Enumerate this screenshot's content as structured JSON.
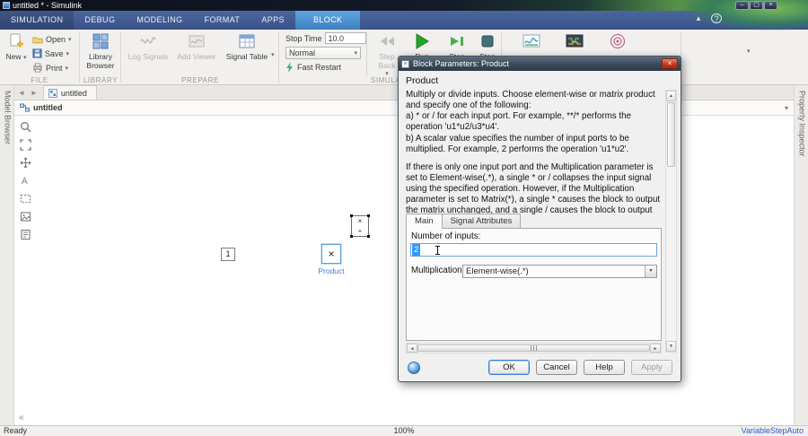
{
  "window": {
    "title": "untitled * - Simulink"
  },
  "icons": {
    "caret_down": "▾",
    "close": "×",
    "minimize": "–",
    "maximize": "▢",
    "scroll_up": "▲",
    "scroll_down": "▼",
    "scroll_left": "◄",
    "scroll_right": "►",
    "nav_back": "◄",
    "nav_forward": "►",
    "collapse_left": "«",
    "ribbon_collapse": "▴",
    "help": "?",
    "product_glyph": "×"
  },
  "ribbon": {
    "tabs": [
      "SIMULATION",
      "DEBUG",
      "MODELING",
      "FORMAT",
      "APPS",
      "BLOCK"
    ]
  },
  "toolbar": {
    "groups": {
      "file": "FILE",
      "library": "LIBRARY",
      "prepare": "PREPARE",
      "simulate": "SIMULATE"
    },
    "new_label": "New",
    "open_label": "Open",
    "save_label": "Save",
    "print_label": "Print",
    "library_browser_label": "Library Browser",
    "log_signals_label": "Log Signals",
    "add_viewer_label": "Add Viewer",
    "signal_table_label": "Signal Table",
    "stop_time_label": "Stop Time",
    "stop_time_value": "10.0",
    "sim_mode_value": "Normal",
    "fast_restart_label": "Fast Restart",
    "step_back_label": "Step Back",
    "run_label": "Run",
    "step_forward_label": "Step Forward",
    "stop_label": "Stop"
  },
  "doc": {
    "tab": "untitled",
    "breadcrumb": "untitled"
  },
  "panels": {
    "left": "Model Browser",
    "right": "Property Inspector"
  },
  "canvas": {
    "constant_value": "1",
    "product_symbol": "×",
    "divide_symbol": "÷",
    "product_label": "Product"
  },
  "dialog": {
    "title": "Block Parameters: Product",
    "heading": "Product",
    "desc_line1": "Multiply or divide inputs.  Choose element-wise or matrix product and specify one of the following:",
    "desc_line2": "a) * or / for each input port. For example, **/* performs the operation 'u1*u2/u3*u4'.",
    "desc_line3": "b) A scalar value specifies the number of input ports to be multiplied. For example, 2 performs the operation 'u1*u2'.",
    "desc_line4": "If there is only one input port and the Multiplication parameter is set to Element-wise(.*), a single * or / collapses the input signal using the specified operation. However, if the Multiplication parameter is set to Matrix(*), a single * causes the block to output the matrix unchanged, and a single / causes the block to output the matrix inverse.",
    "tabs": [
      "Main",
      "Signal Attributes"
    ],
    "number_of_inputs_label": "Number of inputs:",
    "number_of_inputs_value": "2",
    "multiplication_label": "Multiplication:",
    "multiplication_value": "Element-wise(.*)",
    "ok": "OK",
    "cancel": "Cancel",
    "help": "Help",
    "apply": "Apply"
  },
  "status": {
    "left": "Ready",
    "zoom": "100%",
    "right": "VariableStepAuto"
  }
}
